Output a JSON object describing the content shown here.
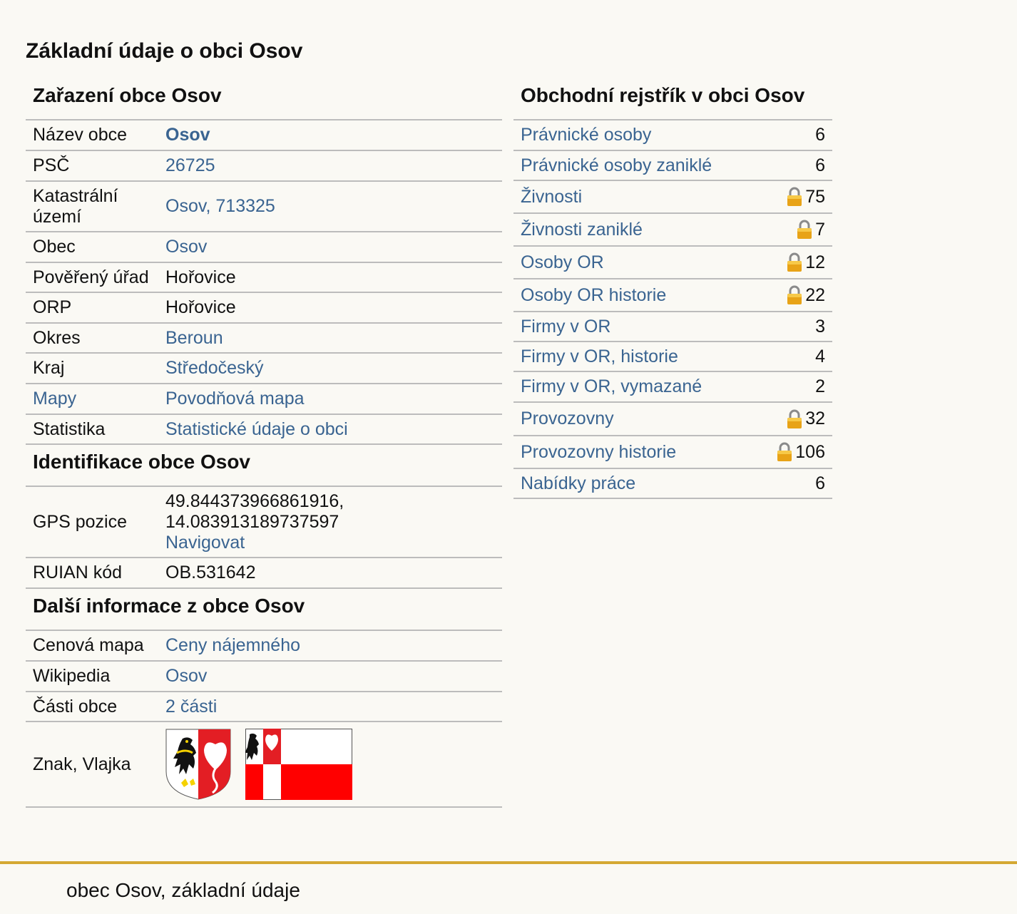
{
  "page": {
    "title": "Základní údaje o obci Osov"
  },
  "zarazeni": {
    "title": "Zařazení obce Osov",
    "rows": [
      {
        "label": "Název obce",
        "value": "Osov"
      },
      {
        "label": "PSČ",
        "value": "26725"
      },
      {
        "label": "Katastrální území",
        "value": "Osov, 713325"
      },
      {
        "label": "Obec",
        "value": "Osov"
      },
      {
        "label": "Pověřený úřad",
        "value": "Hořovice"
      },
      {
        "label": "ORP",
        "value": "Hořovice"
      },
      {
        "label": "Okres",
        "value": "Beroun"
      },
      {
        "label": "Kraj",
        "value": "Středočeský"
      },
      {
        "label": "Mapy",
        "value": "Povodňová mapa"
      },
      {
        "label": "Statistika",
        "value": "Statistické údaje o obci"
      }
    ]
  },
  "identifikace": {
    "title": "Identifikace obce Osov",
    "gps_label": "GPS pozice",
    "gps_lat": "49.844373966861916,",
    "gps_lon": "14.083913189737597",
    "gps_link": "Navigovat",
    "ruian_label": "RUIAN kód",
    "ruian_value": "OB.531642"
  },
  "dalsi": {
    "title": "Další informace z obce Osov",
    "rows": [
      {
        "label": "Cenová mapa",
        "value": "Ceny nájemného"
      },
      {
        "label": "Wikipedia",
        "value": "Osov"
      },
      {
        "label": "Části obce",
        "value": "2 části"
      }
    ],
    "emblem_label": "Znak, Vlajka"
  },
  "rejstrik": {
    "title": "Obchodní rejstřík v obci Osov",
    "rows": [
      {
        "label": "Právnické osoby",
        "count": "6",
        "locked": false
      },
      {
        "label": "Právnické osoby zaniklé",
        "count": "6",
        "locked": false
      },
      {
        "label": "Živnosti",
        "count": "75",
        "locked": true
      },
      {
        "label": "Živnosti zaniklé",
        "count": "7",
        "locked": true
      },
      {
        "label": "Osoby OR",
        "count": "12",
        "locked": true
      },
      {
        "label": "Osoby OR historie",
        "count": "22",
        "locked": true
      },
      {
        "label": "Firmy v OR",
        "count": "3",
        "locked": false
      },
      {
        "label": "Firmy v OR, historie",
        "count": "4",
        "locked": false
      },
      {
        "label": "Firmy v OR, vymazané",
        "count": "2",
        "locked": false
      },
      {
        "label": "Provozovny",
        "count": "32",
        "locked": true
      },
      {
        "label": "Provozovny historie",
        "count": "106",
        "locked": true
      },
      {
        "label": "Nabídky práce",
        "count": "6",
        "locked": false
      }
    ]
  },
  "footer": {
    "text": "obec Osov, základní údaje"
  },
  "colors": {
    "link": "#3a6491",
    "border": "#bcbcbc",
    "footer_accent": "#d4a832",
    "background": "#faf9f4"
  }
}
